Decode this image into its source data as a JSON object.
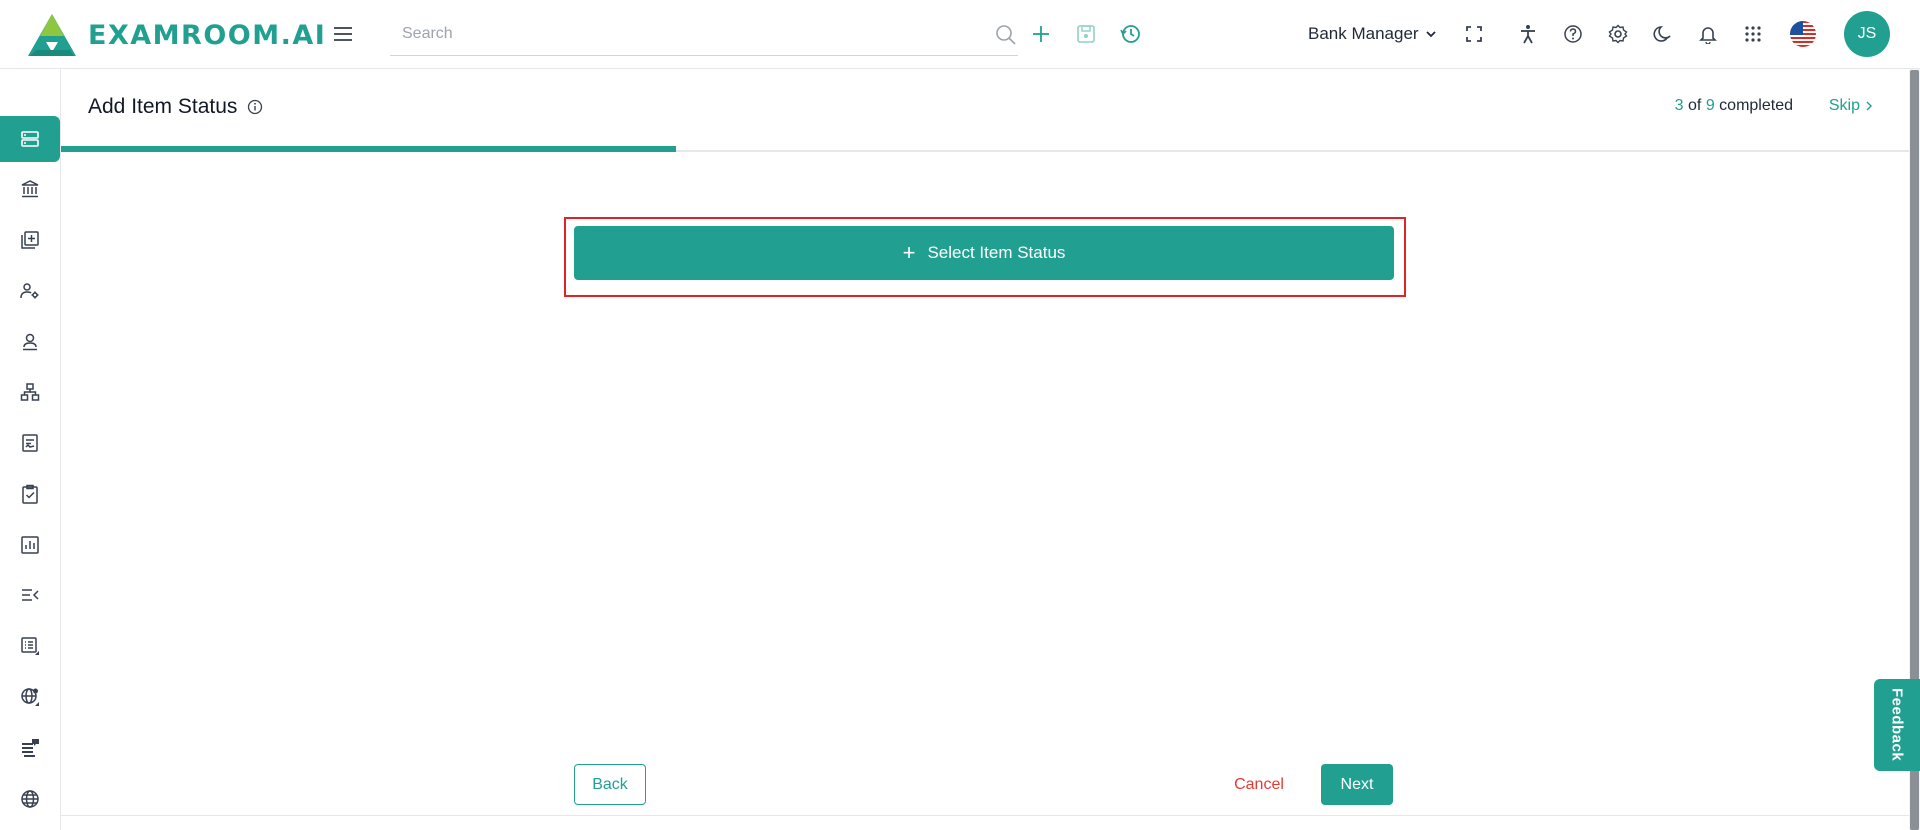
{
  "app": {
    "brand": "EXAMROOM.AI",
    "accent_color": "#21a092"
  },
  "header": {
    "search_placeholder": "Search",
    "role": "Bank Manager",
    "avatar_initials": "JS",
    "icons": [
      "menu-icon",
      "search-icon",
      "add-icon",
      "save-icon",
      "history-icon",
      "fullscreen-icon",
      "accessibility-icon",
      "help-icon",
      "settings-icon",
      "dark-mode-icon",
      "notification-icon",
      "apps-grid-icon",
      "us-flag-icon"
    ]
  },
  "sidebar": {
    "items": [
      "dashboard-icon",
      "bank-icon",
      "add-item-icon",
      "user-settings-icon",
      "user-icon",
      "hierarchy-icon",
      "document-icon",
      "checklist-icon",
      "report-icon",
      "list-collapse-icon",
      "list-icon",
      "globe-settings-icon",
      "stack-chat-icon",
      "globe-icon"
    ],
    "active_index": 0
  },
  "page": {
    "title": "Add Item Status",
    "progress": {
      "current": "3",
      "of": "of",
      "total": "9",
      "suffix": "completed",
      "fraction": 0.333
    },
    "skip_label": "Skip",
    "select_button_label": "Select Item Status",
    "back_label": "Back",
    "cancel_label": "Cancel",
    "next_label": "Next"
  },
  "feedback_label": "Feedback"
}
